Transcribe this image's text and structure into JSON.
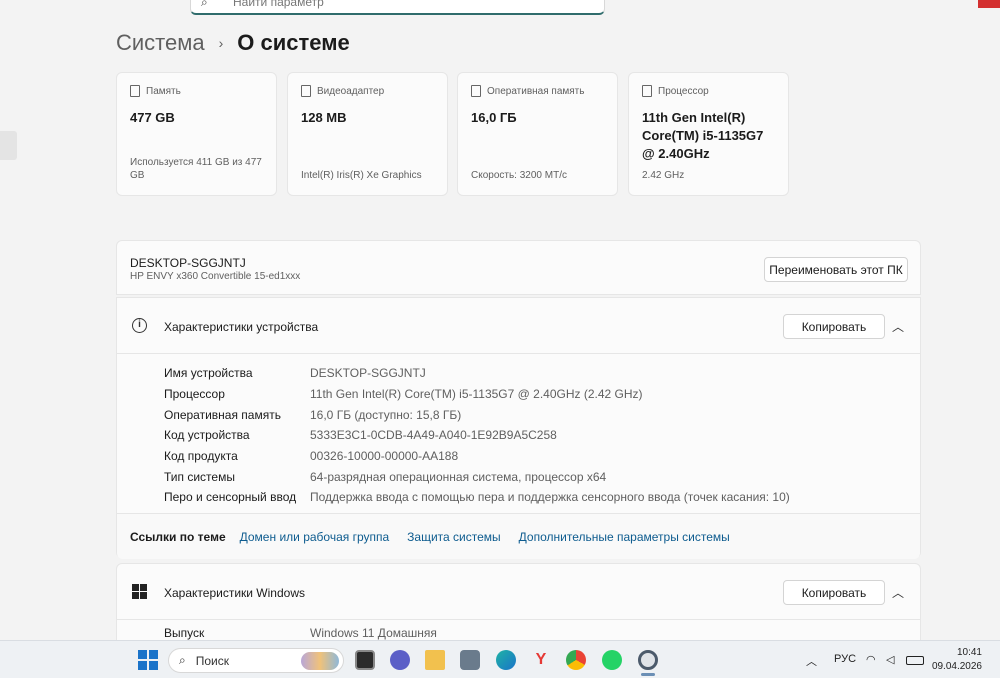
{
  "search": {
    "placeholder": "Найти параметр"
  },
  "breadcrumb": {
    "parent": "Система",
    "separator": "›",
    "current": "О системе"
  },
  "cards": [
    {
      "icon": "storage-icon",
      "label": "Память",
      "value": "477 GB",
      "sub": "Используется 411 GB из 477 GB"
    },
    {
      "icon": "gpu-icon",
      "label": "Видеоадаптер",
      "value": "128 MB",
      "sub": "Intel(R) Iris(R) Xe Graphics"
    },
    {
      "icon": "ram-icon",
      "label": "Оперативная память",
      "value": "16,0 ГБ",
      "sub": "Скорость: 3200 MT/c"
    },
    {
      "icon": "cpu-icon",
      "label": "Процессор",
      "value": "11th Gen Intel(R) Core(TM) i5-1135G7 @ 2.40GHz",
      "sub": "2.42 GHz"
    }
  ],
  "device": {
    "name": "DESKTOP-SGGJNTJ",
    "model": "HP ENVY x360 Convertible 15-ed1xxx",
    "rename_label": "Переименовать этот ПК"
  },
  "device_specs": {
    "title": "Характеристики устройства",
    "copy_label": "Копировать",
    "rows": [
      {
        "k": "Имя устройства",
        "v": "DESKTOP-SGGJNTJ"
      },
      {
        "k": "Процессор",
        "v": "11th Gen Intel(R) Core(TM) i5-1135G7 @ 2.40GHz (2.42 GHz)"
      },
      {
        "k": "Оперативная память",
        "v": "16,0 ГБ (доступно: 15,8 ГБ)"
      },
      {
        "k": "Код устройства",
        "v": "5333E3C1-0CDB-4A49-A040-1E92B9A5C258"
      },
      {
        "k": "Код продукта",
        "v": "00326-10000-00000-AA188"
      },
      {
        "k": "Тип системы",
        "v": "64-разрядная операционная система, процессор x64"
      },
      {
        "k": "Перо и сенсорный ввод",
        "v": "Поддержка ввода с помощью пера и поддержка сенсорного ввода (точек касания: 10)"
      }
    ]
  },
  "related": {
    "label": "Ссылки по теме",
    "links": [
      "Домен или рабочая группа",
      "Защита системы",
      "Дополнительные параметры системы"
    ]
  },
  "windows_specs": {
    "title": "Характеристики Windows",
    "copy_label": "Копировать",
    "rows": [
      {
        "k": "Выпуск",
        "v": "Windows 11 Домашняя"
      }
    ]
  },
  "taskbar": {
    "search_label": "Поиск",
    "lang": "РУС",
    "time": "10:41",
    "date": "09.04.2026"
  },
  "colors": {
    "accent": "#0e5c8f",
    "background": "#f3f3f3",
    "card": "#fbfbfb"
  }
}
